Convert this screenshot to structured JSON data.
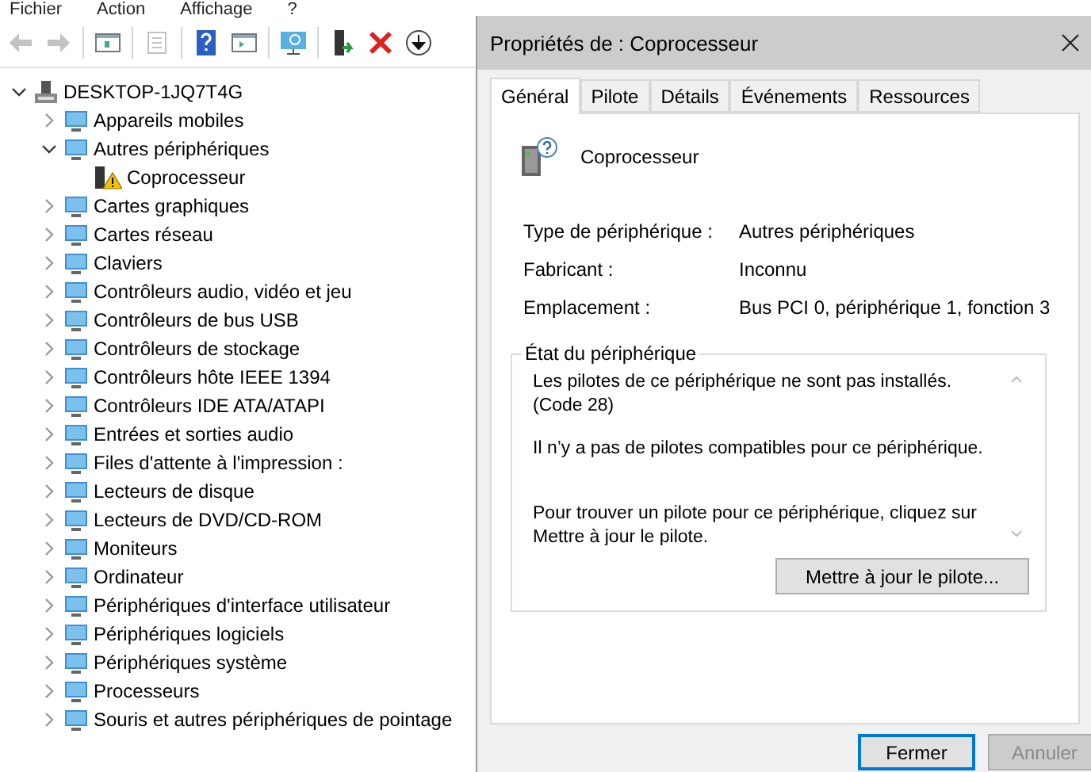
{
  "menu": [
    "Fichier",
    "Action",
    "Affichage",
    "?"
  ],
  "toolbar": [
    {
      "kind": "back",
      "disabled": true
    },
    {
      "kind": "forward",
      "disabled": true
    },
    {
      "kind": "sep"
    },
    {
      "kind": "tree",
      "disabled": false
    },
    {
      "kind": "sep"
    },
    {
      "kind": "props",
      "disabled": true
    },
    {
      "kind": "sep"
    },
    {
      "kind": "help",
      "disabled": false
    },
    {
      "kind": "pane",
      "disabled": false
    },
    {
      "kind": "sep"
    },
    {
      "kind": "scan",
      "disabled": false
    },
    {
      "kind": "sep"
    },
    {
      "kind": "update",
      "disabled": false
    },
    {
      "kind": "remove",
      "disabled": false
    },
    {
      "kind": "download",
      "disabled": false
    }
  ],
  "tree": {
    "label": "DESKTOP-1JQ7T4G",
    "kind": "computer",
    "expanded": true,
    "children": [
      {
        "label": "Appareils mobiles",
        "kind": "category",
        "expanded": false
      },
      {
        "label": "Autres périphériques",
        "kind": "category",
        "expanded": true,
        "children": [
          {
            "label": "Coprocesseur",
            "kind": "warning"
          }
        ]
      },
      {
        "label": "Cartes graphiques",
        "kind": "category",
        "expanded": false
      },
      {
        "label": "Cartes réseau",
        "kind": "category",
        "expanded": false
      },
      {
        "label": "Claviers",
        "kind": "category",
        "expanded": false
      },
      {
        "label": "Contrôleurs audio, vidéo et jeu",
        "kind": "category",
        "expanded": false
      },
      {
        "label": "Contrôleurs de bus USB",
        "kind": "category",
        "expanded": false
      },
      {
        "label": "Contrôleurs de stockage",
        "kind": "category",
        "expanded": false
      },
      {
        "label": "Contrôleurs hôte IEEE 1394",
        "kind": "category",
        "expanded": false
      },
      {
        "label": "Contrôleurs IDE ATA/ATAPI",
        "kind": "category",
        "expanded": false
      },
      {
        "label": "Entrées et sorties audio",
        "kind": "category",
        "expanded": false
      },
      {
        "label": "Files d'attente à l'impression :",
        "kind": "category",
        "expanded": false
      },
      {
        "label": "Lecteurs de disque",
        "kind": "category",
        "expanded": false
      },
      {
        "label": "Lecteurs de DVD/CD-ROM",
        "kind": "category",
        "expanded": false
      },
      {
        "label": "Moniteurs",
        "kind": "category",
        "expanded": false
      },
      {
        "label": "Ordinateur",
        "kind": "category",
        "expanded": false
      },
      {
        "label": "Périphériques d'interface utilisateur",
        "kind": "category",
        "expanded": false
      },
      {
        "label": "Périphériques logiciels",
        "kind": "category",
        "expanded": false
      },
      {
        "label": "Périphériques système",
        "kind": "category",
        "expanded": false
      },
      {
        "label": "Processeurs",
        "kind": "category",
        "expanded": false
      },
      {
        "label": "Souris et autres périphériques de pointage",
        "kind": "category",
        "expanded": false
      }
    ]
  },
  "dialog": {
    "title": "Propriétés de : Coprocesseur",
    "tabs": [
      {
        "label": "Général",
        "selected": true
      },
      {
        "label": "Pilote",
        "selected": false
      },
      {
        "label": "Détails",
        "selected": false
      },
      {
        "label": "Événements",
        "selected": false
      },
      {
        "label": "Ressources",
        "selected": false
      }
    ],
    "device_name": "Coprocesseur",
    "properties": [
      {
        "label": "Type de périphérique :",
        "value": "Autres périphériques"
      },
      {
        "label": "Fabricant :",
        "value": "Inconnu"
      },
      {
        "label": "Emplacement :",
        "value": "Bus PCI 0, périphérique 1, fonction 3"
      }
    ],
    "status": {
      "title": "État du périphérique",
      "paragraphs": [
        "Les pilotes de ce périphérique ne sont pas installés. (Code 28)",
        "Il n’y a pas de pilotes compatibles pour ce périphérique.",
        "Pour trouver un pilote pour ce périphérique, cliquez sur Mettre à jour le pilote."
      ],
      "button": "Mettre à jour le pilote..."
    },
    "buttons": [
      {
        "label": "Fermer",
        "default": true,
        "disabled": false
      },
      {
        "label": "Annuler",
        "default": false,
        "disabled": true
      }
    ]
  }
}
